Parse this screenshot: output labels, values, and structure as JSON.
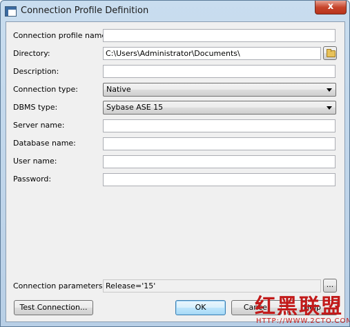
{
  "window": {
    "title": "Connection Profile Definition",
    "close_label": "x"
  },
  "form": {
    "profile_name": {
      "label": "Connection profile name:",
      "value": ""
    },
    "directory": {
      "label": "Directory:",
      "value": "C:\\Users\\Administrator\\Documents\\"
    },
    "description": {
      "label": "Description:",
      "value": ""
    },
    "connection_type": {
      "label": "Connection type:",
      "value": "Native"
    },
    "dbms_type": {
      "label": "DBMS type:",
      "value": "Sybase ASE 15"
    },
    "server_name": {
      "label": "Server name:",
      "value": ""
    },
    "database_name": {
      "label": "Database name:",
      "value": ""
    },
    "user_name": {
      "label": "User name:",
      "value": ""
    },
    "password": {
      "label": "Password:",
      "value": ""
    },
    "connection_parameters": {
      "label": "Connection parameters:",
      "value": "Release='15'",
      "browse_label": "..."
    }
  },
  "buttons": {
    "test_connection": "Test Connection...",
    "ok": "OK",
    "cancel": "Cancel",
    "help": "Help"
  },
  "watermark": {
    "text": "红黑联盟",
    "url": "HTTP://WWW.2CTO.COM"
  },
  "colors": {
    "titlebar": "#c9ddef",
    "close_button": "#c7452c",
    "client_bg": "#f0f0f0",
    "watermark": "#c21a1a"
  }
}
